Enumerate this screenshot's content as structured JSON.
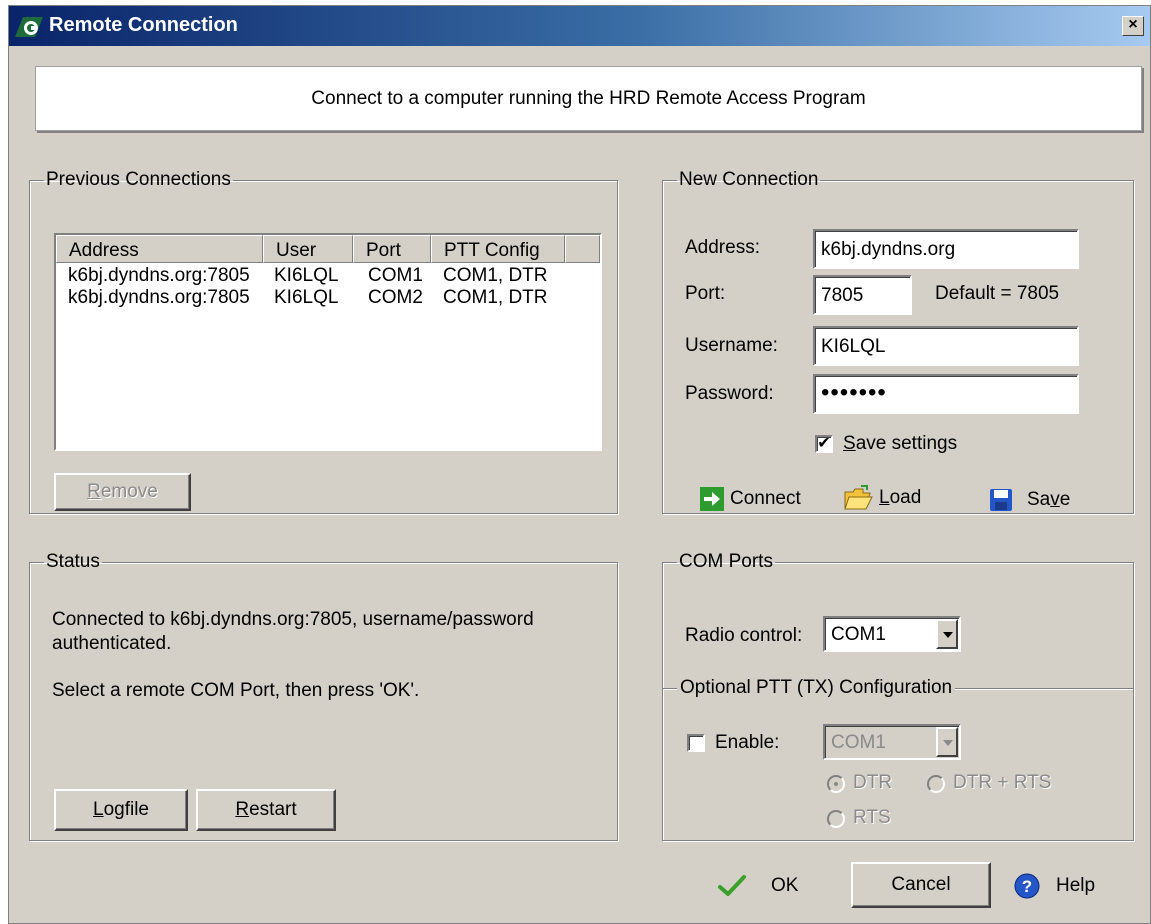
{
  "window": {
    "title": "Remote Connection",
    "close_label": "×"
  },
  "banner": {
    "text": "Connect to a computer running the HRD Remote Access Program"
  },
  "previous_connections": {
    "legend": "Previous Connections",
    "columns": [
      "Address",
      "User",
      "Port",
      "PTT Config"
    ],
    "rows": [
      [
        "k6bj.dyndns.org:7805",
        "KI6LQL",
        "COM1",
        "COM1, DTR"
      ],
      [
        "k6bj.dyndns.org:7805",
        "KI6LQL",
        "COM2",
        "COM1, DTR"
      ]
    ],
    "remove_label_first": "R",
    "remove_label_rest": "emove"
  },
  "new_connection": {
    "legend": "New Connection",
    "address_label": "Address:",
    "address_value": "k6bj.dyndns.org",
    "port_label": "Port:",
    "port_value": "7805",
    "port_default": "Default = 7805",
    "username_label": "Username:",
    "username_value": "KI6LQL",
    "password_label": "Password:",
    "password_value": "•••••••",
    "save_settings_first": "S",
    "save_settings_rest": "ave settings",
    "save_settings_checked": "✔",
    "connect_label": "Connect",
    "load_first": "L",
    "load_rest": "oad",
    "save_pre": "Sa",
    "save_u": "v",
    "save_post": "e"
  },
  "status": {
    "legend": "Status",
    "line1": "Connected to k6bj.dyndns.org:7805, username/password",
    "line2": "authenticated.",
    "line3": "Select a remote COM Port, then press 'OK'.",
    "logfile_first": "L",
    "logfile_rest": "ogfile",
    "restart_first": "R",
    "restart_rest": "estart"
  },
  "com_ports": {
    "legend": "COM Ports",
    "radio_control_label": "Radio control:",
    "radio_control_value": "COM1",
    "ptt_legend": "Optional PTT (TX) Configuration",
    "enable_label": "Enable:",
    "ptt_port_value": "COM1",
    "opt_dtr": "DTR",
    "opt_dtr_rts": "DTR + RTS",
    "opt_rts": "RTS"
  },
  "footer": {
    "ok_label": "OK",
    "cancel_label": "Cancel",
    "help_label": "Help"
  },
  "colors": {
    "titlebar_start": "#0a246a",
    "titlebar_end": "#a6caf0",
    "face": "#d4d0c8",
    "connect_icon": "#2e9b2e",
    "ok_check": "#3aa02a",
    "help_icon": "#2456c8"
  }
}
